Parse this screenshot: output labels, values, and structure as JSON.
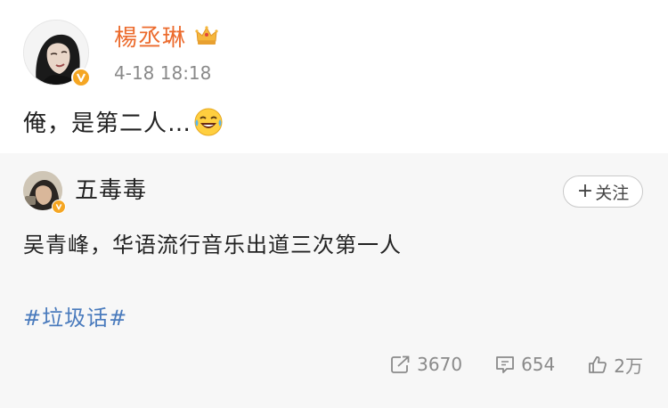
{
  "post": {
    "author": "楊丞琳",
    "time": "4-18 18:18",
    "text": "俺，是第二人…",
    "emoji": "laughing-crying-emoji",
    "badge": "crown-icon"
  },
  "repost": {
    "author": "五毒毒",
    "follow_label": "关注",
    "follow_plus": "+",
    "text": "吴青峰，华语流行音乐出道三次第一人",
    "hashtag": "#垃圾话#",
    "stats": {
      "reposts": "3670",
      "comments": "654",
      "likes": "2万"
    }
  },
  "colors": {
    "author_name": "#ec6b2d",
    "hashtag": "#4a7bbd",
    "verified": "#f5a623",
    "muted": "#8a8a8a",
    "card_bg": "#f7f7f7"
  }
}
